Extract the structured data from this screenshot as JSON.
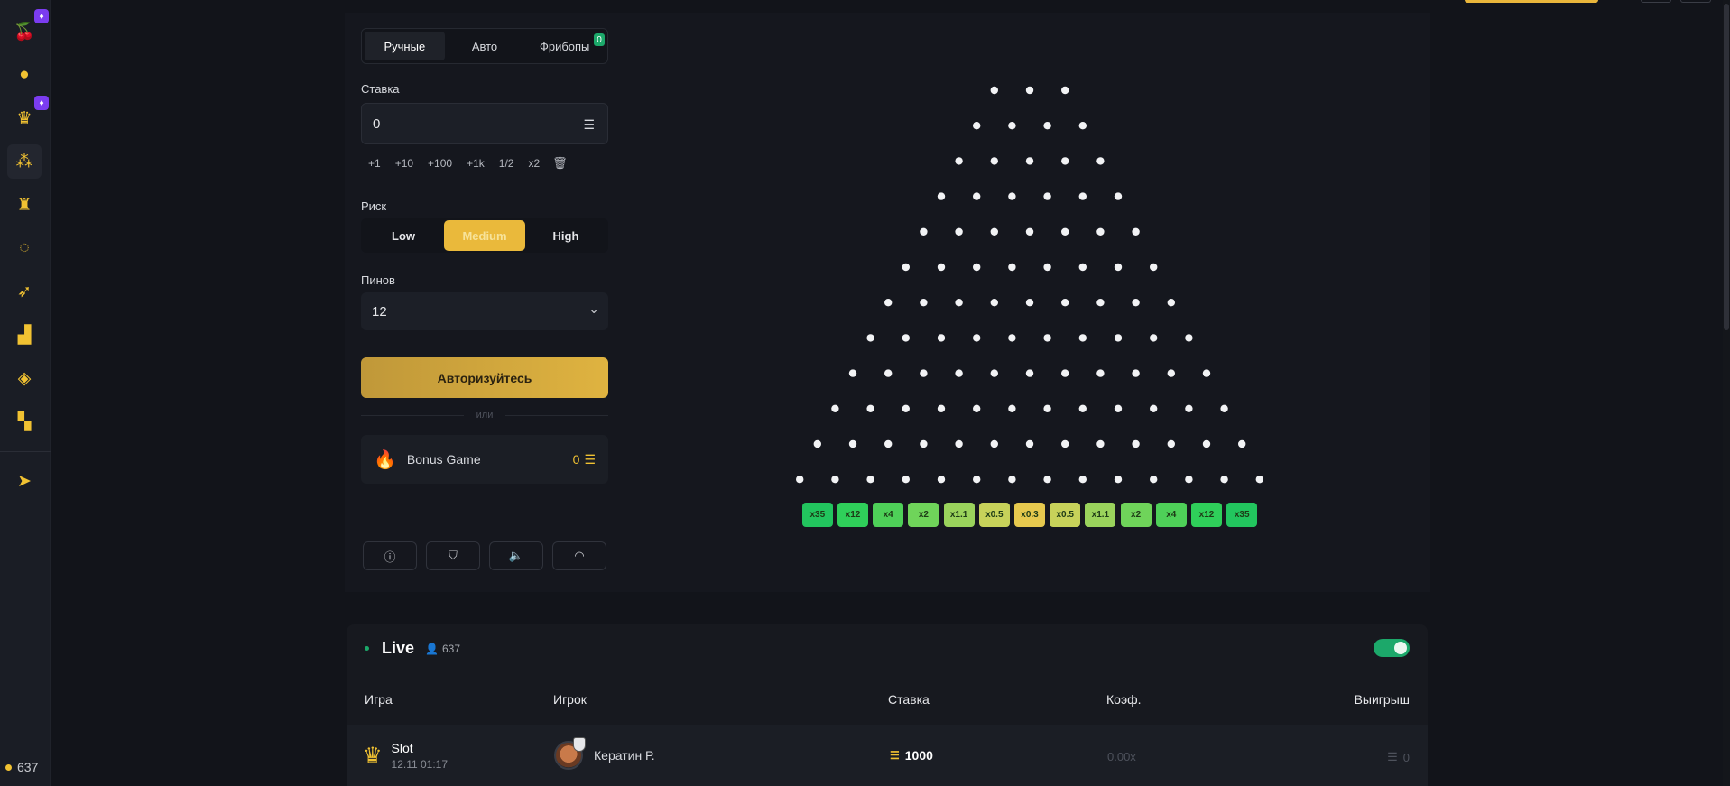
{
  "sidebar": {
    "items": [
      {
        "icon": "cherries-icon",
        "glyph": "🍒",
        "badge": "♦"
      },
      {
        "icon": "bomb-icon",
        "glyph": "●"
      },
      {
        "icon": "crown-icon",
        "glyph": "♛",
        "badge": "♦"
      },
      {
        "icon": "plinko-icon",
        "glyph": "⁂",
        "active": true
      },
      {
        "icon": "tower-icon",
        "glyph": "♜"
      },
      {
        "icon": "wheel-icon",
        "glyph": "◌"
      },
      {
        "icon": "rocket-icon",
        "glyph": "➶"
      },
      {
        "icon": "chart-icon",
        "glyph": "▟"
      },
      {
        "icon": "dice-icon",
        "glyph": "◈"
      },
      {
        "icon": "mines-icon",
        "glyph": "▚"
      },
      {
        "icon": "telegram-icon",
        "glyph": "➤"
      }
    ],
    "online_count": "637"
  },
  "tabs": [
    {
      "label": "Ручные",
      "active": true
    },
    {
      "label": "Авто"
    },
    {
      "label": "Фрибопы",
      "badge": "0"
    }
  ],
  "bet": {
    "label": "Ставка",
    "value": "0",
    "quick": [
      "+1",
      "+10",
      "+100",
      "+1k",
      "1/2",
      "x2"
    ]
  },
  "risk": {
    "label": "Риск",
    "options": [
      {
        "label": "Low"
      },
      {
        "label": "Medium",
        "active": true
      },
      {
        "label": "High"
      }
    ]
  },
  "pins": {
    "label": "Пинов",
    "value": "12"
  },
  "auth_button": "Авторизуйтесь",
  "or_text": "или",
  "bonus": {
    "label": "Bonus Game",
    "value": "0"
  },
  "board": {
    "rows": 12,
    "multipliers": [
      {
        "label": "x35",
        "color": "#22c55e"
      },
      {
        "label": "x12",
        "color": "#2fcf5a"
      },
      {
        "label": "x4",
        "color": "#4ed058"
      },
      {
        "label": "x2",
        "color": "#6fd45a"
      },
      {
        "label": "x1.1",
        "color": "#9ad35c"
      },
      {
        "label": "x0.5",
        "color": "#c7d25a"
      },
      {
        "label": "x0.3",
        "color": "#e6c94e"
      },
      {
        "label": "x0.5",
        "color": "#c7d25a"
      },
      {
        "label": "x1.1",
        "color": "#9ad35c"
      },
      {
        "label": "x2",
        "color": "#6fd45a"
      },
      {
        "label": "x4",
        "color": "#4ed058"
      },
      {
        "label": "x12",
        "color": "#2fcf5a"
      },
      {
        "label": "x35",
        "color": "#22c55e"
      }
    ]
  },
  "live": {
    "title": "Live",
    "count": "637",
    "columns": [
      "Игра",
      "Игрок",
      "Ставка",
      "Коэф.",
      "Выигрыш"
    ],
    "rows": [
      {
        "game": "Slot",
        "time": "12.11 01:17",
        "player": "Кератин Р.",
        "bet": "1000",
        "coef": "0.00x",
        "win": "0"
      }
    ]
  },
  "colors": {
    "accent": "#eab93b",
    "green": "#1ca86a",
    "badge_purple": "#7b3cf0"
  }
}
